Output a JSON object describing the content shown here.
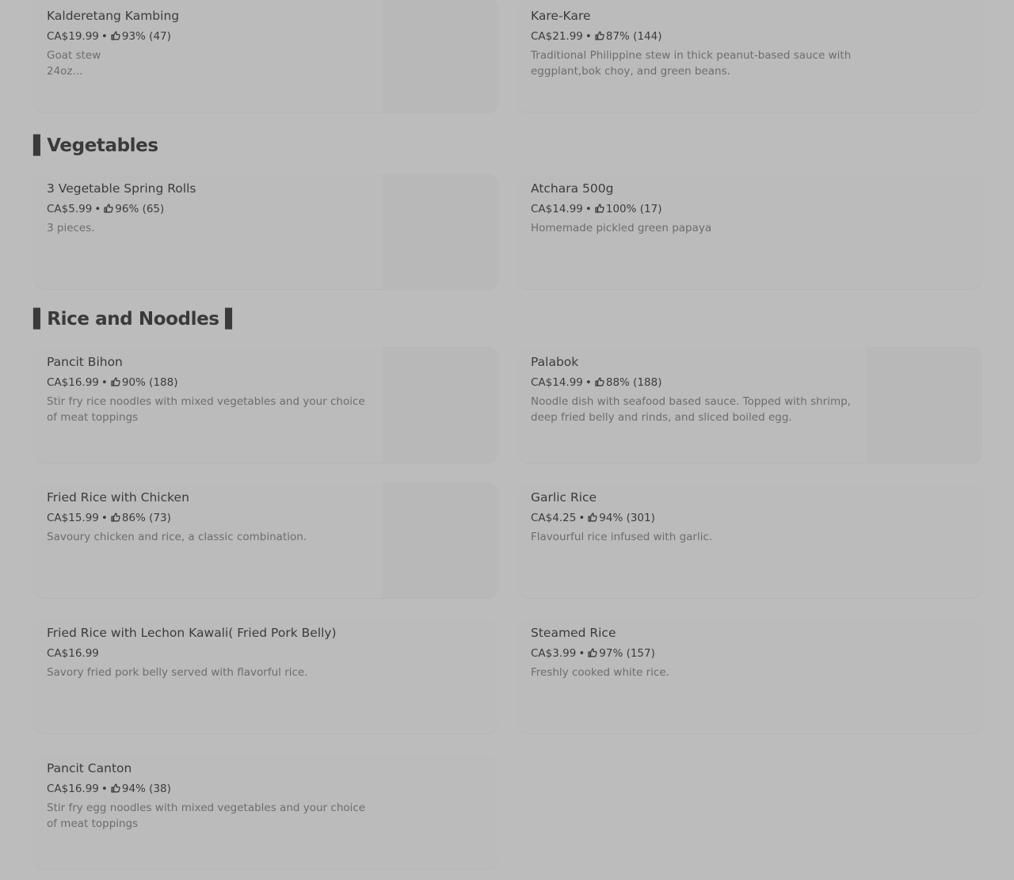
{
  "sections": [
    {
      "title": "",
      "items": [
        {
          "name": "Kalderetang Kambing",
          "price": "CA$19.99",
          "rating": "93% (47)",
          "description": "Goat stew\n24oz..."
        },
        {
          "name": "Kare-Kare",
          "price": "CA$21.99",
          "rating": "87% (144)",
          "description": "Traditional Philippine stew in thick peanut-based sauce with eggplant,bok choy, and green beans."
        }
      ]
    },
    {
      "title": "▌Vegetables",
      "items": [
        {
          "name": "3 Vegetable Spring Rolls",
          "price": "CA$5.99",
          "rating": "96% (65)",
          "description": "3 pieces."
        },
        {
          "name": "Atchara 500g",
          "price": "CA$14.99",
          "rating": "100% (17)",
          "description": "Homemade pickled green papaya"
        }
      ]
    },
    {
      "title": "▌Rice and Noodles ▌",
      "items": [
        {
          "name": "Pancit Bihon",
          "price": "CA$16.99",
          "rating": "90% (188)",
          "description": "Stir fry rice noodles with mixed vegetables and your choice of meat toppings"
        },
        {
          "name": "Palabok",
          "price": "CA$14.99",
          "rating": "88% (188)",
          "description": "Noodle dish with seafood based sauce. Topped with shrimp, deep fried belly and rinds, and sliced boiled egg."
        },
        {
          "name": "Fried Rice with Chicken",
          "price": "CA$15.99",
          "rating": "86% (73)",
          "description": "Savoury chicken and rice, a classic combination."
        },
        {
          "name": "Garlic Rice",
          "price": "CA$4.25",
          "rating": "94% (301)",
          "description": "Flavourful rice infused with garlic."
        },
        {
          "name": "Fried Rice with Lechon Kawali( Fried Pork Belly)",
          "price": "CA$16.99",
          "rating": "",
          "description": "Savory fried pork belly served with flavorful rice."
        },
        {
          "name": "Steamed Rice",
          "price": "CA$3.99",
          "rating": "97% (157)",
          "description": "Freshly cooked white rice."
        },
        {
          "name": "Pancit Canton",
          "price": "CA$16.99",
          "rating": "94% (38)",
          "description": "Stir fry egg noodles with mixed vegetables and your choice of meat toppings"
        }
      ]
    }
  ]
}
